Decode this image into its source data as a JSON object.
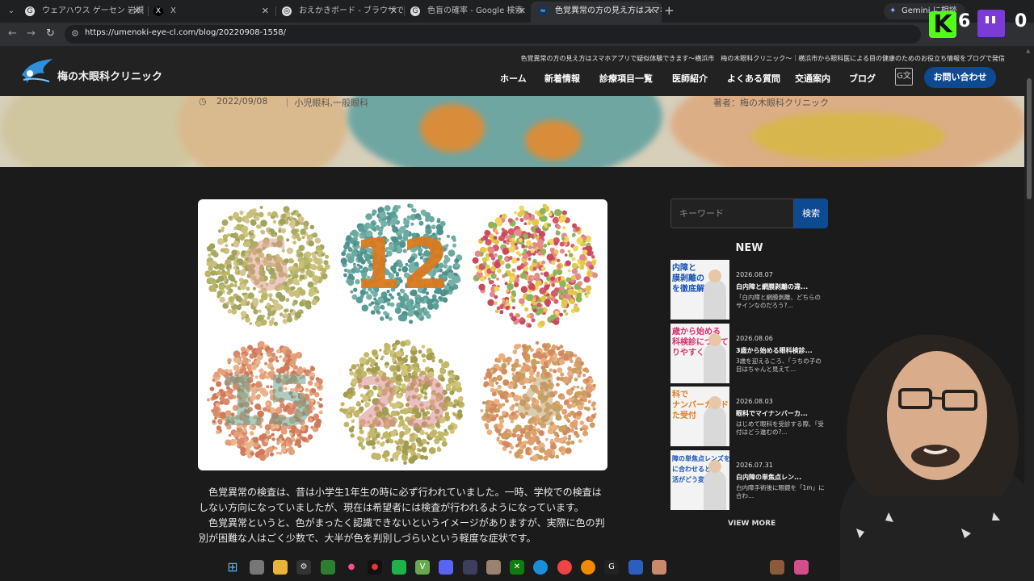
{
  "browser": {
    "tabs": [
      {
        "title": "ウェアハウス ゲーセン 岩槻 - Google",
        "icon": "G"
      },
      {
        "title": "X",
        "icon": "X"
      },
      {
        "title": "おえかきボード - ブラウザでかんたんお",
        "icon": "◎"
      },
      {
        "title": "色盲の確率 - Google 検索",
        "icon": "G"
      },
      {
        "title": "色覚異常の方の見え方はスマホア",
        "icon": "≈"
      }
    ],
    "new_tab": "+",
    "gemini_label": "Gemini に相談",
    "url": "https://umenoki-eye-cl.com/blog/20220908-1558/"
  },
  "stream": {
    "kick_count": "6",
    "twitch_count": "0"
  },
  "site": {
    "logo_text": "梅の木眼科クリニック",
    "tagline": "色覚異常の方の見え方はスマホアプリで疑似体験できます〜横浜市　梅の木眼科クリニック〜｜横浜市から眼科医による目の健康のためのお役立ち情報をブログで発信",
    "nav": [
      "ホーム",
      "新着情報",
      "診療項目一覧",
      "医師紹介",
      "よくある質問",
      "交通案内",
      "ブログ"
    ],
    "contact": "お問い合わせ"
  },
  "article": {
    "date": "2022/09/08",
    "categories": "｜ 小児眼科,一般眼科",
    "author": "著者：梅の木眼科クリニック",
    "plates": [
      "6",
      "12",
      "",
      "15",
      "29",
      "4"
    ],
    "paragraph1": "　色覚異常の検査は、昔は小学生1年生の時に必ず行われていました。一時、学校での検査はしない方向になっていましたが、現在は希望者には検査が行われるようになっています。",
    "paragraph2": "　色覚異常というと、色がまったく認識できないというイメージがありますが、実際に色の判別が困難な人はごく少数で、大半が色を判別しづらいという軽度な症状です。"
  },
  "sidebar": {
    "search_placeholder": "キーワード",
    "search_button": "検索",
    "new_heading": "NEW",
    "posts": [
      {
        "date": "2026.08.07",
        "title": "白内障と網膜剥離の違...",
        "excerpt": "「白内障と網膜剥離、どちらのサインなのだろう?...",
        "thumb": "内障と\n膜剥離の\nを徹底解説!",
        "thumb_color": "#1a55b5"
      },
      {
        "date": "2026.08.06",
        "title": "3歳から始める眼科検診...",
        "excerpt": "3歳を迎えるころ、「うちの子の目はちゃんと見えて...",
        "thumb": "歳から始める\n科検診について\nりやすく解説",
        "thumb_color": "#d6326e"
      },
      {
        "date": "2026.08.03",
        "title": "眼科でマイナンバーカ...",
        "excerpt": "はじめて眼科を受診する際、「受付はどう進むの?...",
        "thumb": "科で\nナンバーカード\nた受付",
        "thumb_color": "#e07b1d"
      },
      {
        "date": "2026.07.31",
        "title": "白内障の単焦点レン...",
        "excerpt": "白内障手術後に眼鏡を「1m」に合わ...",
        "thumb": "障の単焦点レンズを\nに合わせると\n活がどう変わる?",
        "thumb_color": "#1a55b5"
      }
    ],
    "view_more": "VIEW MORE"
  },
  "colors": {
    "brand_blue": "#0e4a92",
    "header_bg": "#222222",
    "page_bg": "#1b1b1b"
  }
}
